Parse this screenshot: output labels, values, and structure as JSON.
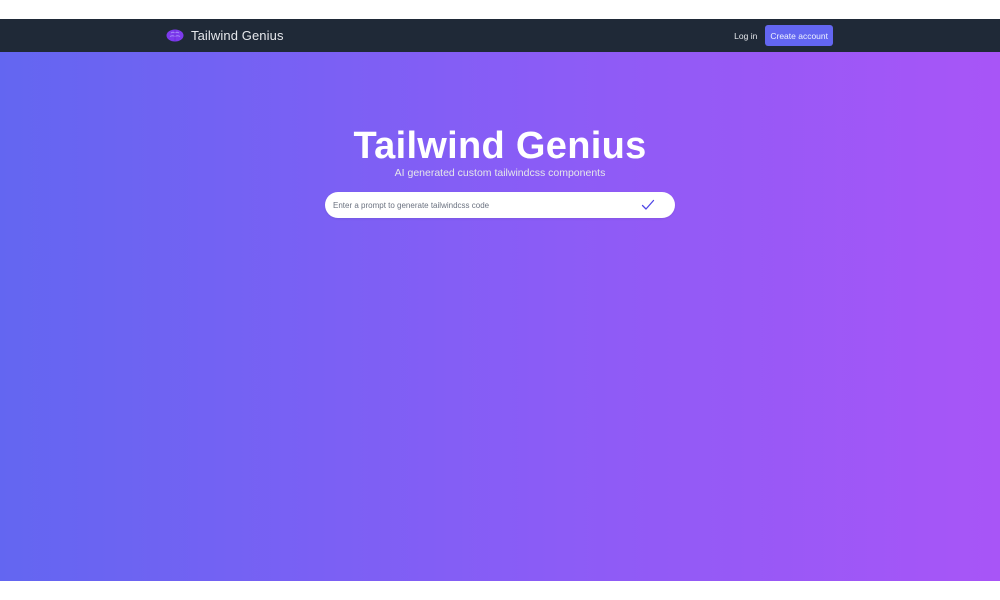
{
  "navbar": {
    "brand_name": "Tailwind Genius",
    "brand_icon": "brain-icon",
    "login_label": "Log in",
    "create_account_label": "Create account"
  },
  "hero": {
    "title": "Tailwind Genius",
    "subtitle": "AI generated custom tailwindcss components"
  },
  "prompt": {
    "placeholder": "Enter a prompt to generate tailwindcss code",
    "value": "",
    "submit_icon": "check-icon"
  },
  "colors": {
    "navbar_bg": "#1f2937",
    "accent": "#6366f1",
    "gradient_start": "#6366f1",
    "gradient_end": "#a855f7",
    "logo": "#7c3aed"
  }
}
